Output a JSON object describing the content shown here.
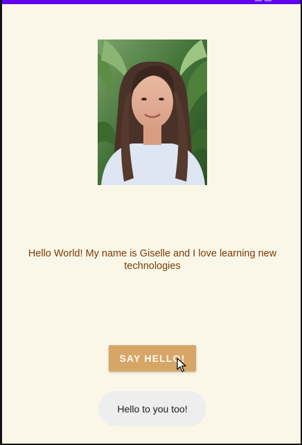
{
  "app": {
    "accent_color": "#6200ee",
    "background_color": "#fbf7e8"
  },
  "profile": {
    "photo_icon": "portrait-photo",
    "intro_text": "Hello World! My name is Giselle and I love learning new technologies"
  },
  "actions": {
    "say_hello_label": "SAY HELLO!",
    "button_color": "#d7a667"
  },
  "toast": {
    "message": "Hello to you too!"
  }
}
